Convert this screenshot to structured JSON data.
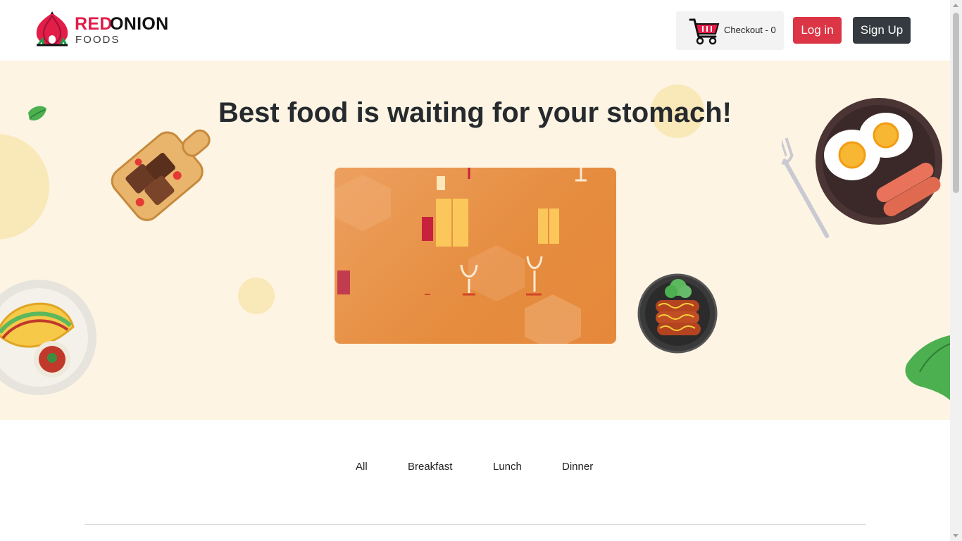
{
  "brand": {
    "name_red": "RED",
    "name_dark": "ONION",
    "sub": "FOODS"
  },
  "header": {
    "checkout_label": "Checkout - 0",
    "login_label": "Log in",
    "signup_label": "Sign Up"
  },
  "hero": {
    "title": "Best food is waiting for your stomach!"
  },
  "menu_tabs": [
    "All",
    "Breakfast",
    "Lunch",
    "Dinner"
  ],
  "colors": {
    "brand_red": "#e11d48",
    "login_btn": "#dc3545",
    "signup_btn": "#343a40",
    "hero_bg": "#fdf4e3"
  },
  "icons": [
    "onion-logo-icon",
    "shopping-cart-icon"
  ]
}
